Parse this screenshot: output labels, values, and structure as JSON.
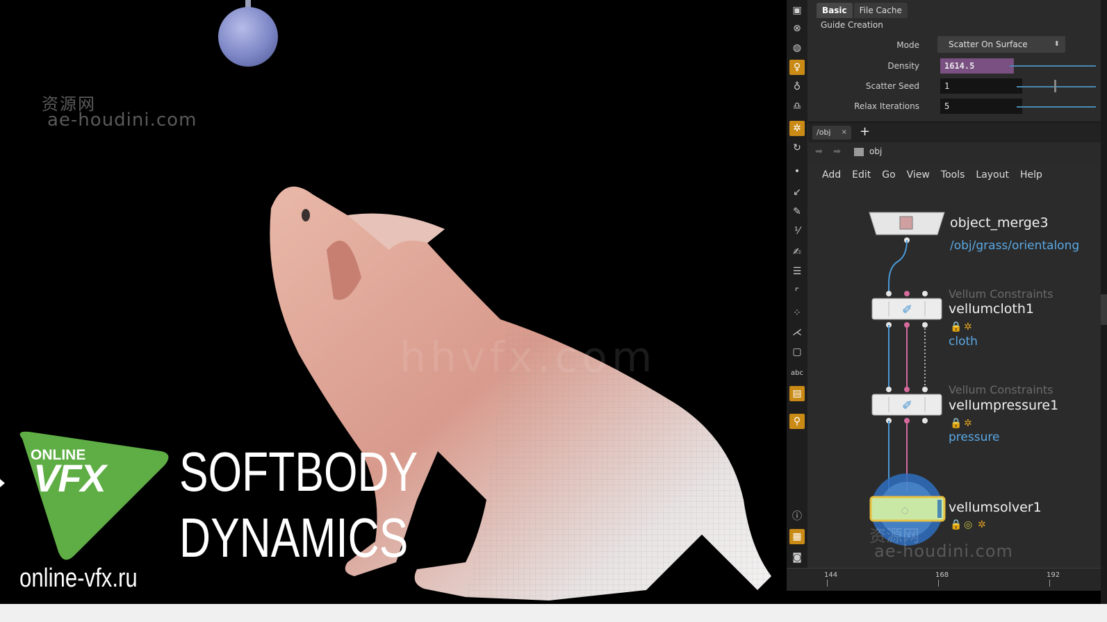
{
  "viewport": {
    "watermark_cn": "资源网",
    "watermark_url": "ae-houdini.com",
    "watermark_center": "hhvfx.com",
    "logo_online": "ONLINE",
    "logo_vfx": "VFX",
    "title_line1": "SOFTBODY",
    "title_line2": "DYNAMICS",
    "site": "online-vfx.ru",
    "logo_color": "#5fae45"
  },
  "toolbar": {
    "icons": [
      "lock-icon",
      "pose-icon",
      "sphere-tool-icon",
      "light-icon",
      "light-add-icon",
      "camera-icon",
      "handle-icon",
      "rotate-icon",
      "point-icon",
      "pen-icon",
      "brush-icon",
      "measure-icon",
      "paint-icon",
      "comb-icon",
      "corner-icon",
      "scatter-icon",
      "branch-icon",
      "box-icon",
      "text-icon",
      "image-icon",
      "pin-icon",
      "info-icon",
      "grid-icon",
      "camera-view-icon"
    ]
  },
  "parameters": {
    "tabs": [
      "Basic",
      "File Cache"
    ],
    "section": "Guide Creation",
    "mode_label": "Mode",
    "mode_value": "Scatter On Surface",
    "density_label": "Density",
    "density_value": "1614.5",
    "seed_label": "Scatter Seed",
    "seed_value": "1",
    "relax_label": "Relax Iterations",
    "relax_value": "5"
  },
  "network": {
    "path_tab": "/obj",
    "path": "obj",
    "menu": [
      "Add",
      "Edit",
      "Go",
      "View",
      "Tools",
      "Layout",
      "Help"
    ],
    "nodes": {
      "merge": {
        "name": "object_merge3",
        "comment": "/obj/grass/orientalong"
      },
      "cloth": {
        "type": "Vellum Constraints",
        "name": "vellumcloth1",
        "comment": "cloth"
      },
      "pressure": {
        "type": "Vellum Constraints",
        "name": "vellumpressure1",
        "comment": "pressure"
      },
      "solver": {
        "name": "vellumsolver1"
      }
    },
    "watermark_cn": "资源网",
    "watermark_url": "ae-houdini.com"
  },
  "timeline": {
    "frames": [
      "144",
      "168",
      "192"
    ]
  }
}
